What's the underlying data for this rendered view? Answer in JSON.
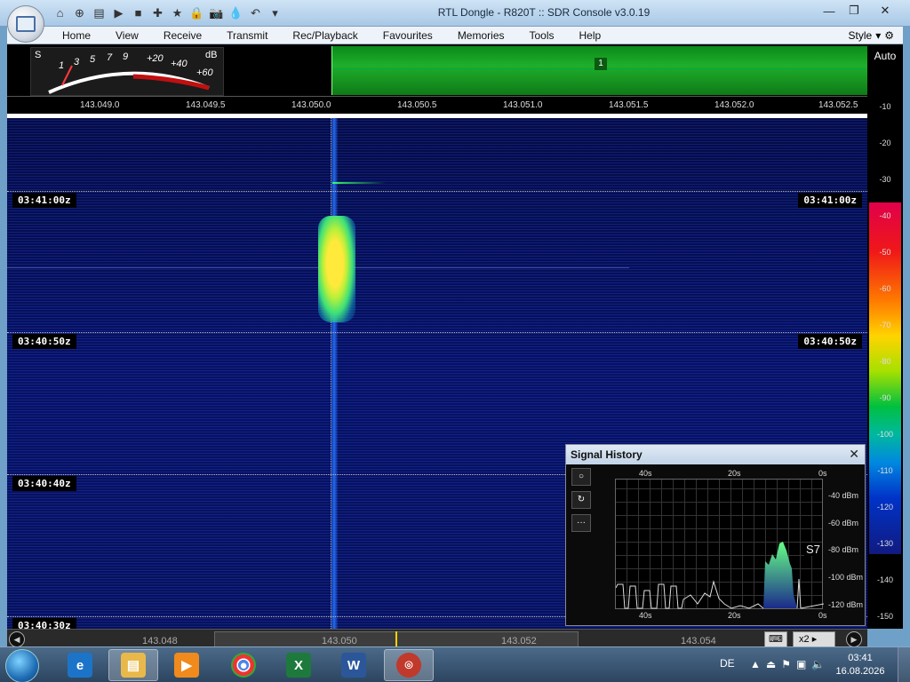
{
  "window": {
    "title": "RTL Dongle - R820T :: SDR Console v3.0.19",
    "controls": [
      "—",
      "❐",
      "✕"
    ]
  },
  "quick_access": [
    "⌂",
    "⊕",
    "▤",
    "▶",
    "■",
    "✚",
    "★",
    "🔒",
    "📷",
    "💧",
    "↶",
    "▾"
  ],
  "menu": {
    "items": [
      "Home",
      "View",
      "Receive",
      "Transmit",
      "Rec/Playback",
      "Favourites",
      "Memories",
      "Tools",
      "Help"
    ],
    "style_label": "Style"
  },
  "smeter": {
    "s_label": "S",
    "db_label": "dB",
    "ticks": [
      "1",
      "3",
      "5",
      "7",
      "9",
      "+20",
      "+40",
      "+60"
    ]
  },
  "spectrum": {
    "slot_number": "1",
    "auto_label": "Auto"
  },
  "frequency_scale": [
    "143.049.0",
    "143.049.5",
    "143.050.0",
    "143.050.5",
    "143.051.0",
    "143.051.5",
    "143.052.0",
    "143.052.5"
  ],
  "waterfall": {
    "time_labels": [
      "03:41:00z",
      "03:40:50z",
      "03:40:40z",
      "03:40:30z"
    ]
  },
  "color_scale": [
    "-10",
    "-20",
    "-30",
    "-40",
    "-50",
    "-60",
    "-70",
    "-80",
    "-90",
    "-100",
    "-110",
    "-120",
    "-130",
    "-140",
    "-150"
  ],
  "signal_history": {
    "title": "Signal History",
    "time_top": [
      "40s",
      "20s",
      "0s"
    ],
    "time_bottom": [
      "40s",
      "20s",
      "0s"
    ],
    "db_labels": [
      "-40 dBm",
      "-60 dBm",
      "-80 dBm",
      "-100 dBm",
      "-120 dBm"
    ],
    "s_reading": "S7",
    "buttons": [
      "○",
      "↻",
      "···"
    ]
  },
  "bottom_bar": {
    "freqs": [
      "143.048",
      "143.050",
      "143.052",
      "143.054"
    ],
    "zoom": "x2"
  },
  "taskbar": {
    "apps": [
      "e",
      "▤",
      "▶",
      "●",
      "X",
      "W",
      "⌾"
    ],
    "language": "DE",
    "time": "03:41",
    "date": "16.08.2026"
  }
}
